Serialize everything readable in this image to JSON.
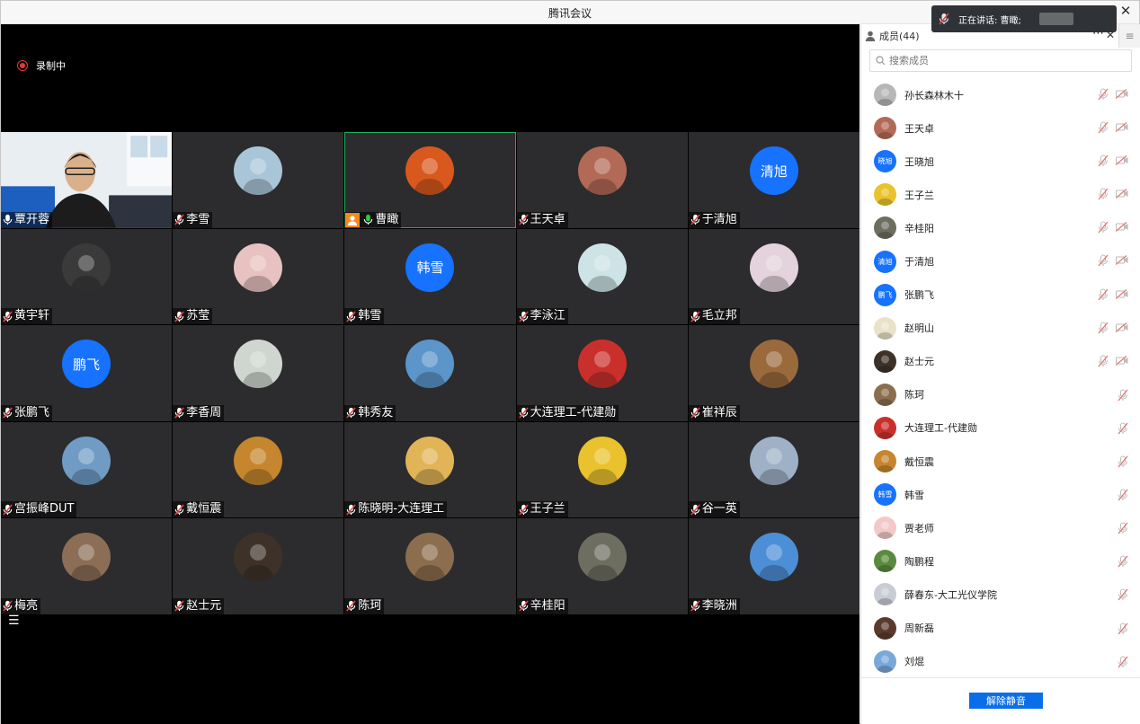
{
  "window": {
    "title": "腾讯会议"
  },
  "recording": {
    "label": "录制中"
  },
  "toast": {
    "text": "正在讲话: 曹瞰;"
  },
  "colors": {
    "accent": "#0a6ee8",
    "host_badge": "#f08c1c",
    "active_border": "#1fae5b",
    "rec": "#e53935"
  },
  "tiles": [
    {
      "name": "覃开蓉",
      "kind": "camera",
      "mic": "on"
    },
    {
      "name": "李雪",
      "kind": "photo",
      "bg": "#a9c6d8",
      "mic": "off"
    },
    {
      "name": "曹瞰",
      "kind": "photo",
      "bg": "#d9581e",
      "mic": "on",
      "host": true,
      "active": true
    },
    {
      "name": "王天卓",
      "kind": "photo",
      "bg": "#b26a56",
      "mic": "off"
    },
    {
      "name": "于清旭",
      "kind": "text",
      "initials": "清旭",
      "bg": "#1672ff",
      "mic": "off"
    },
    {
      "name": "黄宇轩",
      "kind": "photo",
      "bg": "#3a3a3a",
      "mic": "off"
    },
    {
      "name": "苏莹",
      "kind": "photo",
      "bg": "#e8c2c0",
      "mic": "off"
    },
    {
      "name": "韩雪",
      "kind": "text",
      "initials": "韩雪",
      "bg": "#1672ff",
      "mic": "off"
    },
    {
      "name": "李泳江",
      "kind": "photo",
      "bg": "#cde3e6",
      "mic": "off"
    },
    {
      "name": "毛立邦",
      "kind": "photo",
      "bg": "#e4d3dc",
      "mic": "off"
    },
    {
      "name": "张鹏飞",
      "kind": "text",
      "initials": "鹏飞",
      "bg": "#1672ff",
      "mic": "off"
    },
    {
      "name": "李香周",
      "kind": "photo",
      "bg": "#cfd6cf",
      "mic": "off"
    },
    {
      "name": "韩秀友",
      "kind": "photo",
      "bg": "#5b95c9",
      "mic": "off"
    },
    {
      "name": "大连理工-代建勋",
      "kind": "photo",
      "bg": "#c9302c",
      "mic": "off"
    },
    {
      "name": "崔祥辰",
      "kind": "photo",
      "bg": "#9a6a3c",
      "mic": "off"
    },
    {
      "name": "宫振峰DUT",
      "kind": "photo",
      "bg": "#6f9bc5",
      "mic": "off"
    },
    {
      "name": "戴恒震",
      "kind": "photo",
      "bg": "#c5862d",
      "mic": "off"
    },
    {
      "name": "陈晓明-大连理工",
      "kind": "photo",
      "bg": "#e1b457",
      "mic": "off"
    },
    {
      "name": "王子兰",
      "kind": "photo",
      "bg": "#e9c22d",
      "mic": "off"
    },
    {
      "name": "谷一英",
      "kind": "photo",
      "bg": "#9fb1c7",
      "mic": "off"
    },
    {
      "name": "梅亮",
      "kind": "photo",
      "bg": "#8b6e55",
      "mic": "off"
    },
    {
      "name": "赵士元",
      "kind": "photo",
      "bg": "#3e3228",
      "mic": "off"
    },
    {
      "name": "陈珂",
      "kind": "photo",
      "bg": "#8c6e4e",
      "mic": "off"
    },
    {
      "name": "辛桂阳",
      "kind": "photo",
      "bg": "#6d6d60",
      "mic": "off"
    },
    {
      "name": "李晓洲",
      "kind": "photo",
      "bg": "#4d8fd6",
      "mic": "off"
    }
  ],
  "panel": {
    "title": "成员(44)",
    "more_icon": "⋯",
    "close_icon": "✕",
    "search_placeholder": "搜索成员",
    "unmute_label": "解除静音",
    "members": [
      {
        "name": "孙长森林木十",
        "bg": "#b7b7b7",
        "video": true
      },
      {
        "name": "王天卓",
        "bg": "#b26a56",
        "video": true
      },
      {
        "name": "王晓旭",
        "initials": "晓旭",
        "bg": "#1672ff",
        "video": true
      },
      {
        "name": "王子兰",
        "bg": "#e9c22d",
        "video": true
      },
      {
        "name": "辛桂阳",
        "bg": "#6d6d60",
        "video": true
      },
      {
        "name": "于清旭",
        "initials": "清旭",
        "bg": "#1672ff",
        "video": true
      },
      {
        "name": "张鹏飞",
        "initials": "鹏飞",
        "bg": "#1672ff",
        "video": true
      },
      {
        "name": "赵明山",
        "bg": "#e9e2c8",
        "video": true
      },
      {
        "name": "赵士元",
        "bg": "#3e3228",
        "video": true
      },
      {
        "name": "陈珂",
        "bg": "#8c6e4e",
        "video": false
      },
      {
        "name": "大连理工-代建勋",
        "bg": "#c9302c",
        "video": false
      },
      {
        "name": "戴恒震",
        "bg": "#c5862d",
        "video": false
      },
      {
        "name": "韩雪",
        "initials": "韩雪",
        "bg": "#1672ff",
        "video": false
      },
      {
        "name": "贾老师",
        "bg": "#f2c9c9",
        "video": false
      },
      {
        "name": "陶鹏程",
        "bg": "#5a8a3c",
        "video": false
      },
      {
        "name": "薛春东-大工光仪学院",
        "bg": "#c8ccd4",
        "video": false
      },
      {
        "name": "周新磊",
        "bg": "#5b3a2e",
        "video": false
      },
      {
        "name": "刘焜",
        "bg": "#7aa7d9",
        "video": false
      }
    ]
  }
}
